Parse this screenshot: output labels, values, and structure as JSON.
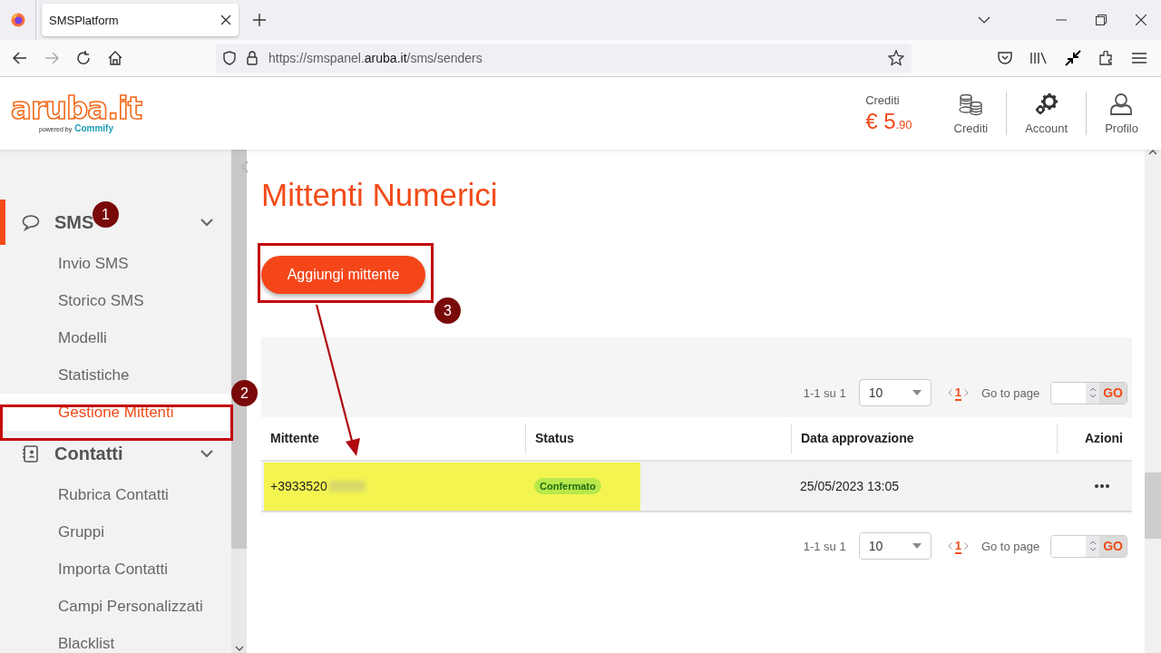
{
  "browser": {
    "tab_title": "SMSPlatform",
    "url_prefix": "https://smspanel.",
    "url_domain": "aruba.it",
    "url_path": "/sms/senders"
  },
  "header": {
    "logo": "aruba.it",
    "logo_by": "powered by",
    "logo_brand": "Commify",
    "credit_label": "Crediti",
    "credit_main": "€ 5",
    "credit_cents": ".90",
    "nav": [
      {
        "label": "Crediti",
        "kind": "coins"
      },
      {
        "label": "Account",
        "kind": "gear"
      },
      {
        "label": "Profilo",
        "kind": "user"
      }
    ]
  },
  "sidebar": {
    "sections": [
      {
        "label": "SMS",
        "kind": "chat",
        "expanded": true,
        "active": true,
        "items": [
          {
            "label": "Invio SMS",
            "selected": false
          },
          {
            "label": "Storico SMS",
            "selected": false
          },
          {
            "label": "Modelli",
            "selected": false
          },
          {
            "label": "Statistiche",
            "selected": false
          },
          {
            "label": "Gestione Mittenti",
            "selected": true
          }
        ]
      },
      {
        "label": "Contatti",
        "kind": "contacts",
        "expanded": true,
        "active": false,
        "items": [
          {
            "label": "Rubrica Contatti",
            "selected": false
          },
          {
            "label": "Gruppi",
            "selected": false
          },
          {
            "label": "Importa Contatti",
            "selected": false
          },
          {
            "label": "Campi Personalizzati",
            "selected": false
          },
          {
            "label": "Blacklist",
            "selected": false
          }
        ]
      }
    ]
  },
  "page": {
    "title": "Mittenti Numerici",
    "add_button": "Aggiungi mittente",
    "pagers": [
      {
        "range": "1-1 su 1",
        "page_size": "10",
        "page": "1",
        "goto_label": "Go to page",
        "go": "GO"
      },
      {
        "range": "1-1 su 1",
        "page_size": "10",
        "page": "1",
        "goto_label": "Go to page",
        "go": "GO"
      }
    ],
    "table": {
      "columns": [
        "Mittente",
        "Status",
        "Data approvazione",
        "Azioni"
      ],
      "rows": [
        {
          "sender": "+3933520",
          "sender_blurred": true,
          "status": "Confermato",
          "date": "25/05/2023 13:05",
          "highlighted": true
        }
      ]
    }
  },
  "annotations": {
    "markers": [
      {
        "number": "1"
      },
      {
        "number": "2"
      },
      {
        "number": "3"
      }
    ]
  }
}
